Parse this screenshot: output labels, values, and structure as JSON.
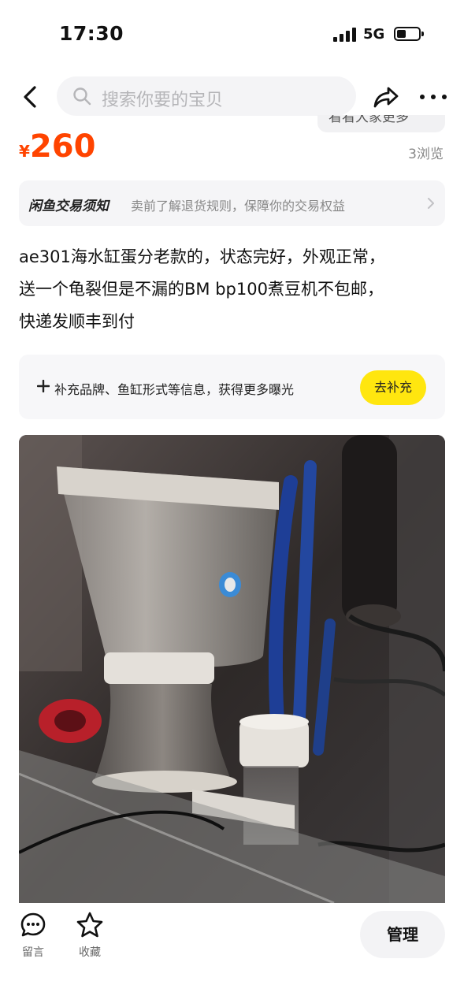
{
  "status_bar": {
    "time": "17:30",
    "network": "5G"
  },
  "nav": {
    "search_placeholder": "搜索你要的宝贝"
  },
  "partial_chip": {
    "label": "看看大家更多"
  },
  "product": {
    "currency": "¥",
    "price": "260",
    "views": "3浏览",
    "description_lines": [
      "ae301海水缸蛋分老款的，状态完好，外观正常，",
      "送一个龟裂但是不漏的BM bp100煮豆机不包邮，",
      "快递发顺丰到付"
    ]
  },
  "notice": {
    "logo": "闲鱼交易须知",
    "text": "卖前了解退货规则，保障你的交易权益"
  },
  "supplement": {
    "text": "补充品牌、鱼缸形式等信息，获得更多曝光",
    "button": "去补充"
  },
  "bottom_bar": {
    "comment_label": "留言",
    "favorite_label": "收藏",
    "manage_label": "管理"
  },
  "colors": {
    "price": "#ff4400",
    "accent_button": "#ffe60f",
    "muted_text": "#888888"
  },
  "icons": [
    "back-arrow-icon",
    "search-icon",
    "share-icon",
    "more-icon",
    "chevron-right-icon",
    "plus-icon",
    "comment-icon",
    "star-icon"
  ]
}
